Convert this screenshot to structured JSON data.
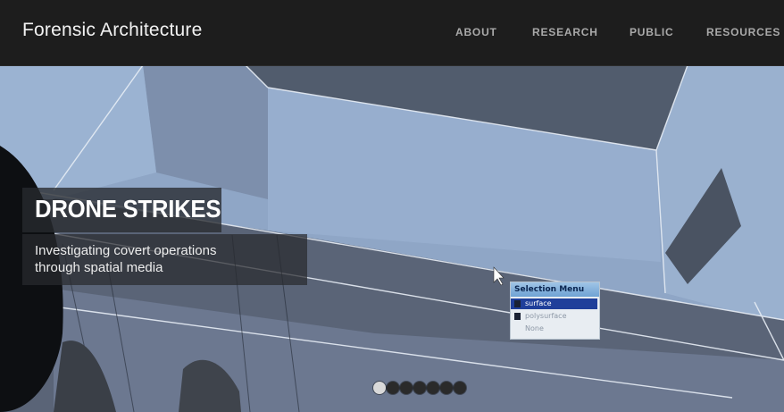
{
  "header": {
    "brand": "Forensic Architecture",
    "nav": [
      {
        "label": "ABOUT"
      },
      {
        "label": "RESEARCH"
      },
      {
        "label": "PUBLIC"
      },
      {
        "label": "RESOURCES"
      }
    ]
  },
  "hero": {
    "title": "DRONE STRIKES",
    "subtitle_line1": "Investigating covert operations",
    "subtitle_line2": "through spatial media",
    "slider": {
      "count": 7,
      "active_index": 0
    },
    "selection_menu": {
      "title": "Selection Menu",
      "options": [
        "surface",
        "polysurface",
        "None"
      ],
      "selected": "surface"
    }
  },
  "colors": {
    "header_bg": "#1d1d1d",
    "nav_text": "#a9a9a9",
    "scene_blue": "#93a9c9"
  }
}
